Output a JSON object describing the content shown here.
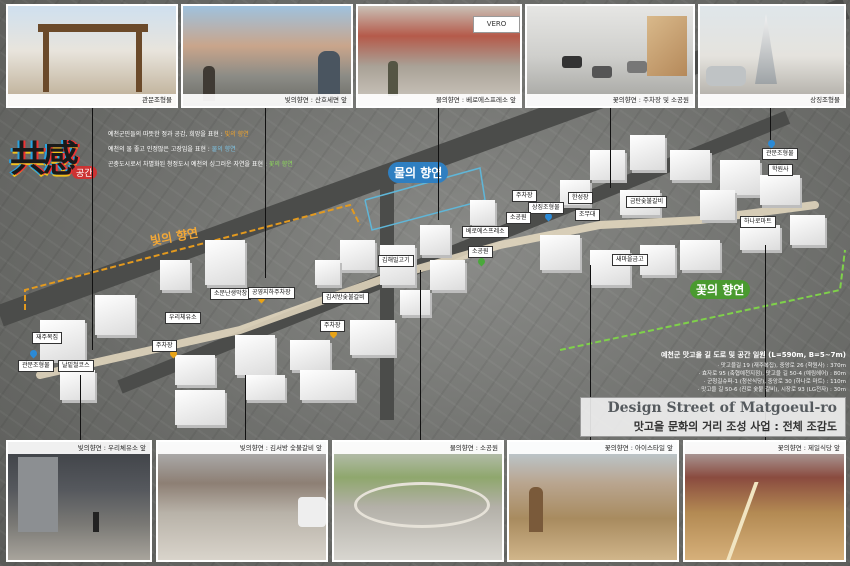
{
  "logo": {
    "text": "共感",
    "sub": "공간"
  },
  "themes": [
    {
      "text": "예천군민들의 따뜻한 정과 공감, 희망을 표현 :",
      "key": "빛의 향연"
    },
    {
      "text": "예천의 물 좋고 인정많은 고장임을 표현 :",
      "key": "물의 향연"
    },
    {
      "text": "곤충도시로서 차별화된 청정도시 예천의 싱그러운 자연을 표현 :",
      "key": "꽃의 향연"
    }
  ],
  "zones": {
    "light": "빛의 향연",
    "water": "물의 향연",
    "flower": "꽃의 향연"
  },
  "top_photos": [
    {
      "caption": "관문조형물"
    },
    {
      "caption": "빛의향연 : 산호세면 앞"
    },
    {
      "caption": "물의향연 : 베로에스프레소 앞"
    },
    {
      "caption": "꽃의향연 : 주차장 및 소공원"
    },
    {
      "caption": "상징조형물"
    }
  ],
  "bottom_photos": [
    {
      "caption": "빛의향연 : 우리체유소 앞"
    },
    {
      "caption": "빛의향연 : 김서방 숯불갈비 앞"
    },
    {
      "caption": "물의향연 : 소공원"
    },
    {
      "caption": "꽃의향연 : 아이스타일 앞"
    },
    {
      "caption": "꽃의향연 : 제일식당 앞"
    }
  ],
  "map_labels": [
    "관문조형물",
    "재주복집",
    "날밑철코스",
    "우리체유소",
    "주차장",
    "소문난생막창",
    "공영지하주차장",
    "김서방숯불갈비",
    "주차장",
    "김해밀고기",
    "베로에스프레소",
    "소공원",
    "주차장",
    "상징조형물",
    "소공원",
    "한성장",
    "조무대",
    "금탄숯불갈비",
    "새마을금고",
    "하나로마트",
    "관문조형물",
    "학원사"
  ],
  "project_info": {
    "range": "예천군 맛고을 길 도로 및 공간 일원 (L=590m, B=5~7m)",
    "details": [
      "· 맛고을길 19 (재주복집), 중앙로 26 (학원사) : 370m",
      "· 효자로 95 (축협예천지점), 맛고을 길 50-4 (예림헤어) : 80m",
      "· 군청길슈퍼-1 (청산식당), 중앙로 30 (하나로 마트) : 110m",
      "· 맛고을 길 50-6 (진로 숯불 갈비), 시장로 93 (LG전자) : 30m"
    ]
  },
  "title_en": "Design Street of Matgoeul-ro",
  "title_ko": "맛고을 문화의 거리 조성 사업 : 전체 조감도",
  "colors": {
    "light_zone": "#e39a1f",
    "water_zone": "#5fb6d8",
    "flower_zone": "#7fd14a",
    "title_en": "#555a5e"
  }
}
